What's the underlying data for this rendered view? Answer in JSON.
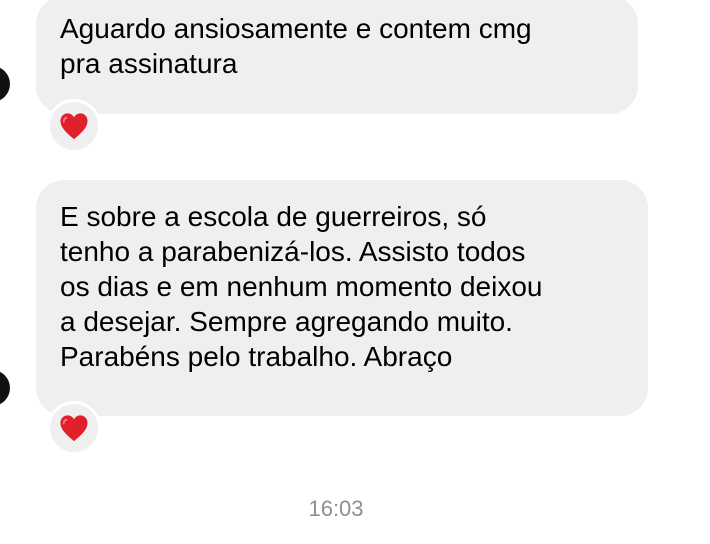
{
  "messages": [
    {
      "lines": [
        "Aguardo ansiosamente e contem cmg",
        "pra assinatura"
      ],
      "reaction": "heart-icon"
    },
    {
      "lines": [
        "E sobre a escola de guerreiros, só",
        "tenho a parabenizá-los. Assisto todos",
        "os dias e em nenhum momento deixou",
        "a desejar. Sempre agregando muito.",
        "Parabéns pelo trabalho. Abraço"
      ],
      "reaction": "heart-icon"
    }
  ],
  "timestamp": "16:03",
  "colors": {
    "bubble": "#efefef",
    "heart": "#e0202a",
    "timestamp": "#8e8e93"
  }
}
